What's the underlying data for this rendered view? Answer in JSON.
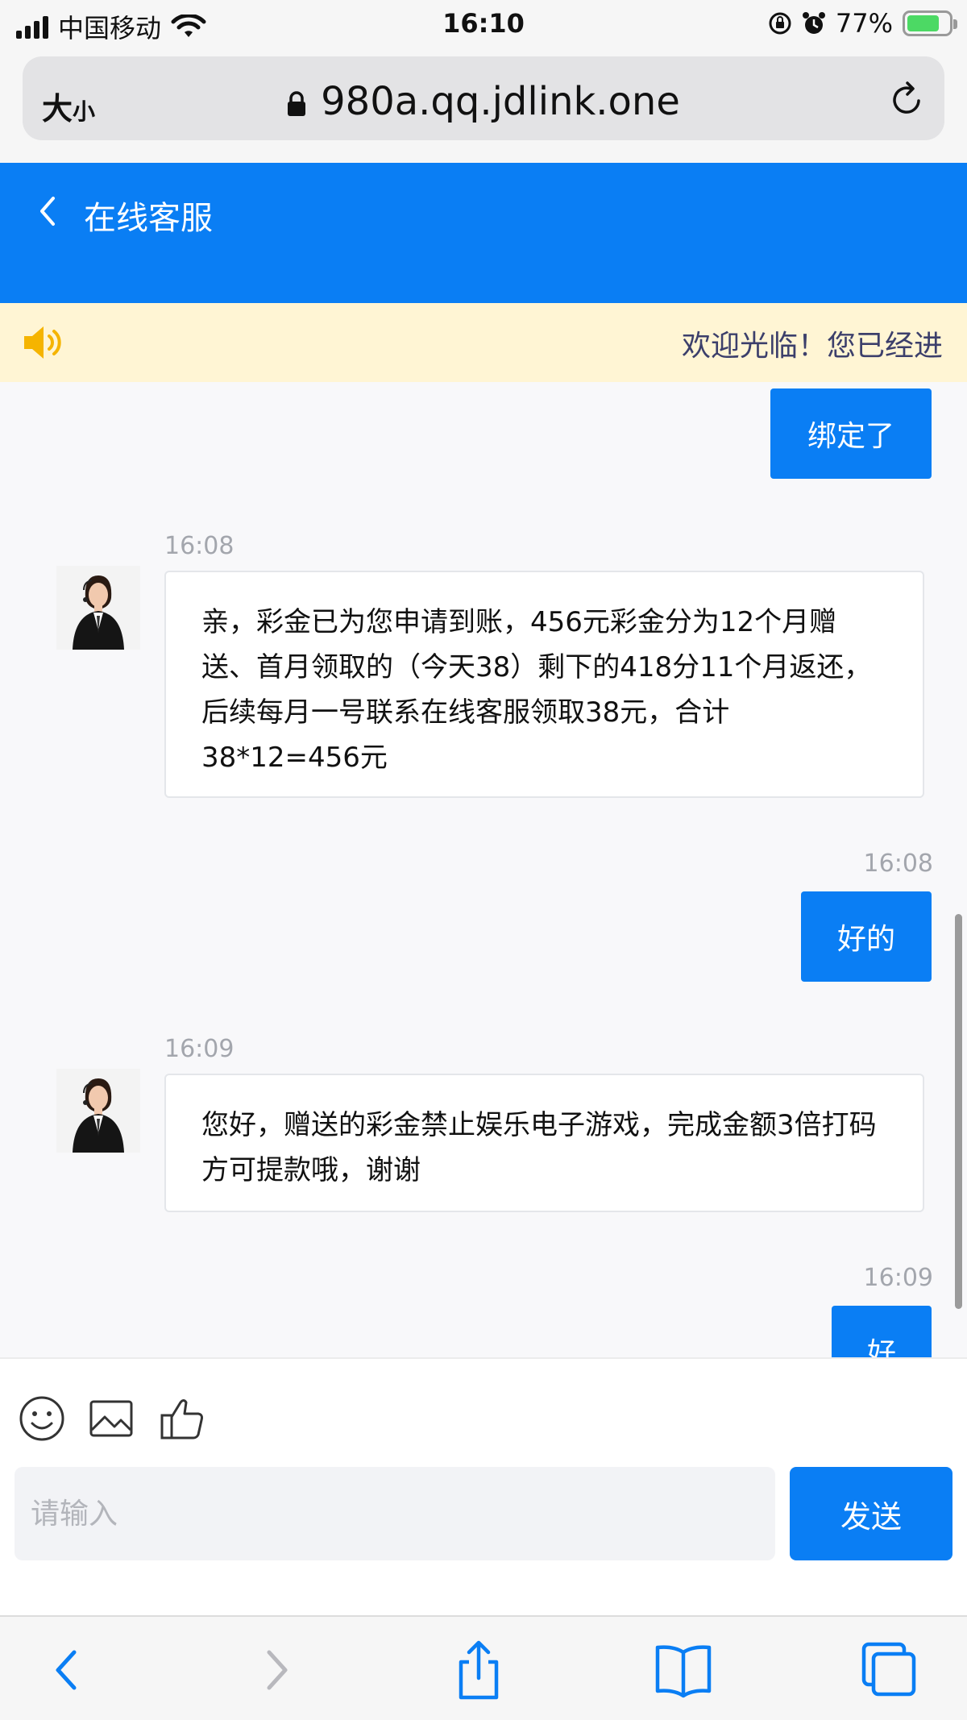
{
  "status_bar": {
    "carrier": "中国移动",
    "time": "16:10",
    "battery": "77%",
    "battery_level": 0.77
  },
  "browser": {
    "text_size_label": "大",
    "text_size_small": "小",
    "url": "980a.qq.jdlink.one"
  },
  "header": {
    "title": "在线客服"
  },
  "notice": {
    "text": "欢迎光临！您已经进"
  },
  "messages": [
    {
      "direction": "out",
      "text": "绑定了"
    },
    {
      "direction": "in",
      "time": "16:08",
      "text": "亲，彩金已为您申请到账，456元彩金分为12个月赠送、首月领取的（今天38）剩下的418分11个月返还，后续每月一号联系在线客服领取38元，合计38*12=456元"
    },
    {
      "direction": "out",
      "time": "16:08",
      "text": "好的"
    },
    {
      "direction": "in",
      "time": "16:09",
      "text": "您好，赠送的彩金禁止娱乐电子游戏，完成金额3倍打码方可提款哦，谢谢"
    },
    {
      "direction": "out",
      "time": "16:09",
      "text": "好"
    }
  ],
  "composer": {
    "placeholder": "请输入",
    "send_label": "发送"
  },
  "colors": {
    "primary": "#0a7ef4",
    "notice_bg": "#fff5d4",
    "speaker": "#f5b400"
  },
  "icons": [
    "emoji-icon",
    "image-icon",
    "thumbs-up-icon",
    "back-icon",
    "forward-icon",
    "share-icon",
    "bookmarks-icon",
    "tabs-icon"
  ]
}
